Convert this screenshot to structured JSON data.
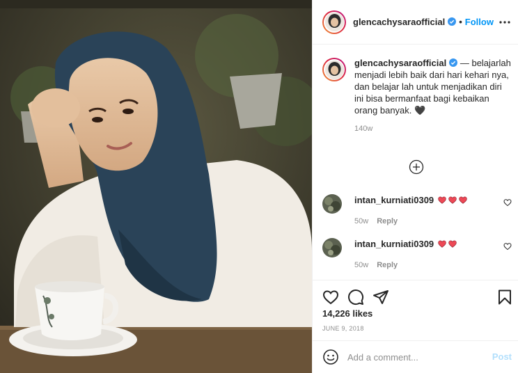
{
  "post": {
    "username": "glencachysaraofficial",
    "follow_label": "Follow",
    "separator": "•"
  },
  "caption": {
    "username": "glencachysaraofficial",
    "text": " — belajarlah menjadi lebih baik dari hari kehari nya, dan belajar lah untuk menjadikan diri ini bisa bermanfaat bagi kebaikan orang banyak. 🖤",
    "time": "140w"
  },
  "comments": [
    {
      "username": "intan_kurniati0309",
      "hearts": 3,
      "time": "50w",
      "reply_label": "Reply"
    },
    {
      "username": "intan_kurniati0309",
      "hearts": 2,
      "time": "50w",
      "reply_label": "Reply"
    }
  ],
  "likes": "14,226 likes",
  "date": "JUNE 9, 2018",
  "add_comment": {
    "placeholder": "Add a comment...",
    "post_label": "Post"
  },
  "icons": {
    "more": "more-horizontal-icon",
    "load_more": "plus-circle-icon",
    "like": "heart-icon",
    "comment": "comment-icon",
    "share": "paper-plane-icon",
    "save": "bookmark-icon",
    "emoji": "smiley-icon"
  },
  "colors": {
    "link": "#0095f6",
    "post_disabled": "#b2dffc",
    "meta": "#8e8e8e",
    "heart": "#ed4956"
  }
}
